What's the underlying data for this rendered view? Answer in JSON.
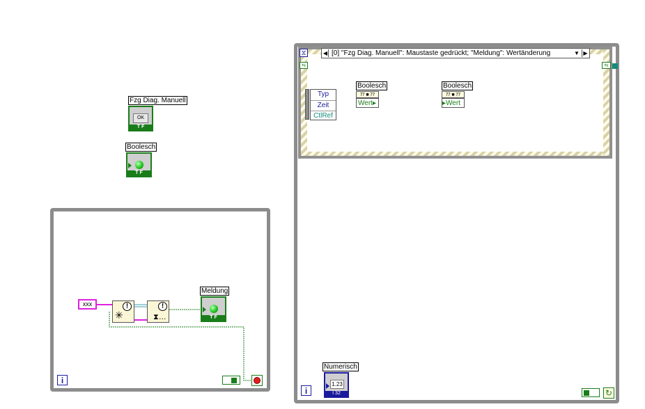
{
  "left_controls": {
    "fzg_label": "Fzg Diag. Manuell",
    "fzg_button_text": "OK",
    "bool_label": "Boolesch"
  },
  "while_loop_left": {
    "const_text": "xxx",
    "meldung_label": "Meldung",
    "iteration": "i"
  },
  "event_structure": {
    "case_text": "[0] \"Fzg Diag. Manuell\": Maustaste gedrückt;  \"Meldung\": Wertänderung",
    "event_data_nodes": [
      "Typ",
      "Zeit",
      "CtlRef"
    ],
    "prop_node_1_label": "Boolesch",
    "prop_node_1_field": "Wert",
    "prop_node_2_label": "Boolesch",
    "prop_node_2_field": "Wert"
  },
  "while_loop_right": {
    "numeric_label": "Numerisch",
    "numeric_value": "1.23",
    "iteration": "i"
  },
  "colors": {
    "bool_wire": "#1a7d1a",
    "string_wire": "#e020e0",
    "loop_border": "#8c8c8c",
    "numeric_wire": "#1a1a9c"
  }
}
